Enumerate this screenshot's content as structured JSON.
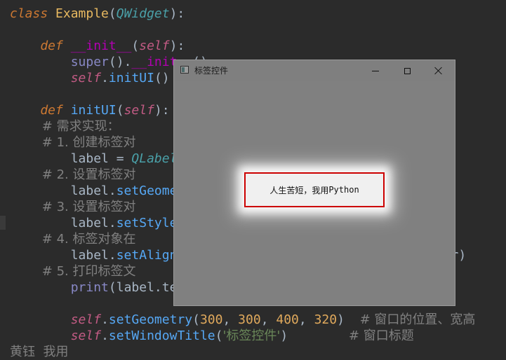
{
  "editor": {
    "lines": [
      [
        {
          "t": "class ",
          "c": "kw"
        },
        {
          "t": "Example",
          "c": "cls"
        },
        {
          "t": "(",
          "c": "plain"
        },
        {
          "t": "QWidget",
          "c": "base"
        },
        {
          "t": "):",
          "c": "plain"
        }
      ],
      [],
      [
        {
          "t": "    def ",
          "c": "kw"
        },
        {
          "t": "__init__",
          "c": "dunder"
        },
        {
          "t": "(",
          "c": "plain"
        },
        {
          "t": "self",
          "c": "self"
        },
        {
          "t": "):",
          "c": "plain"
        }
      ],
      [
        {
          "t": "        ",
          "c": "plain"
        },
        {
          "t": "super",
          "c": "builtin"
        },
        {
          "t": "().",
          "c": "plain"
        },
        {
          "t": "__init__",
          "c": "dunder"
        },
        {
          "t": "()",
          "c": "plain"
        }
      ],
      [
        {
          "t": "        ",
          "c": "plain"
        },
        {
          "t": "self",
          "c": "self"
        },
        {
          "t": ".",
          "c": "plain"
        },
        {
          "t": "initUI",
          "c": "method"
        },
        {
          "t": "()",
          "c": "plain"
        }
      ],
      [],
      [
        {
          "t": "    def ",
          "c": "kw"
        },
        {
          "t": "initUI",
          "c": "fn"
        },
        {
          "t": "(",
          "c": "plain"
        },
        {
          "t": "self",
          "c": "self"
        },
        {
          "t": "):",
          "c": "plain"
        }
      ],
      [
        {
          "t": "        # 需求实现：",
          "c": "cmt"
        }
      ],
      [
        {
          "t": "        # 1. 创建标签对",
          "c": "cmt"
        }
      ],
      [
        {
          "t": "        label = ",
          "c": "plain"
        },
        {
          "t": "QLabel",
          "c": "base"
        }
      ],
      [
        {
          "t": "        # 2. 设置标签对",
          "c": "cmt"
        }
      ],
      [
        {
          "t": "        label.",
          "c": "plain"
        },
        {
          "t": "setGeome",
          "c": "method"
        }
      ],
      [
        {
          "t": "        # 3. 设置标签对",
          "c": "cmt"
        }
      ],
      [
        {
          "t": "        label.",
          "c": "plain"
        },
        {
          "t": "setStyle",
          "c": "method"
        }
      ],
      [
        {
          "t": "        # 4. 标签对象在",
          "c": "cmt"
        }
      ],
      [
        {
          "t": "        label.",
          "c": "plain"
        },
        {
          "t": "setAlign",
          "c": "method"
        },
        {
          "t": "                                   er)",
          "c": "plain"
        }
      ],
      [
        {
          "t": "        # 5. 打印标签文",
          "c": "cmt"
        }
      ],
      [
        {
          "t": "        ",
          "c": "plain"
        },
        {
          "t": "print",
          "c": "builtin"
        },
        {
          "t": "(label.te",
          "c": "plain"
        }
      ],
      [],
      [
        {
          "t": "        ",
          "c": "plain"
        },
        {
          "t": "self",
          "c": "self"
        },
        {
          "t": ".",
          "c": "plain"
        },
        {
          "t": "setGeometry",
          "c": "method"
        },
        {
          "t": "(",
          "c": "plain"
        },
        {
          "t": "300",
          "c": "num"
        },
        {
          "t": ", ",
          "c": "plain"
        },
        {
          "t": "300",
          "c": "num"
        },
        {
          "t": ", ",
          "c": "plain"
        },
        {
          "t": "400",
          "c": "num"
        },
        {
          "t": ", ",
          "c": "plain"
        },
        {
          "t": "320",
          "c": "num"
        },
        {
          "t": ")  ",
          "c": "plain"
        },
        {
          "t": "# 窗口的位置、宽高",
          "c": "cmt"
        }
      ],
      [
        {
          "t": "        ",
          "c": "plain"
        },
        {
          "t": "self",
          "c": "self"
        },
        {
          "t": ".",
          "c": "plain"
        },
        {
          "t": "setWindowTitle",
          "c": "method"
        },
        {
          "t": "(",
          "c": "plain"
        },
        {
          "t": "'标签控件'",
          "c": "str"
        },
        {
          "t": ")        ",
          "c": "plain"
        },
        {
          "t": "# 窗口标题",
          "c": "cmt"
        }
      ],
      [
        {
          "t": "黄钰  我用 ",
          "c": "cmt"
        }
      ]
    ]
  },
  "window": {
    "title": "标签控件",
    "label_text": "人生苦短，我用 Python",
    "label_text_cn": "人生苦短，我用 ",
    "label_text_en": "Python"
  },
  "colors": {
    "editor_bg": "#2b2b2b",
    "window_bg": "#808080",
    "label_border": "#cc0000",
    "label_bg": "#f0f0f0"
  },
  "icons": {
    "window_icon": "qt-window-icon",
    "minimize": "minimize-icon",
    "maximize": "maximize-icon",
    "close": "close-icon"
  }
}
